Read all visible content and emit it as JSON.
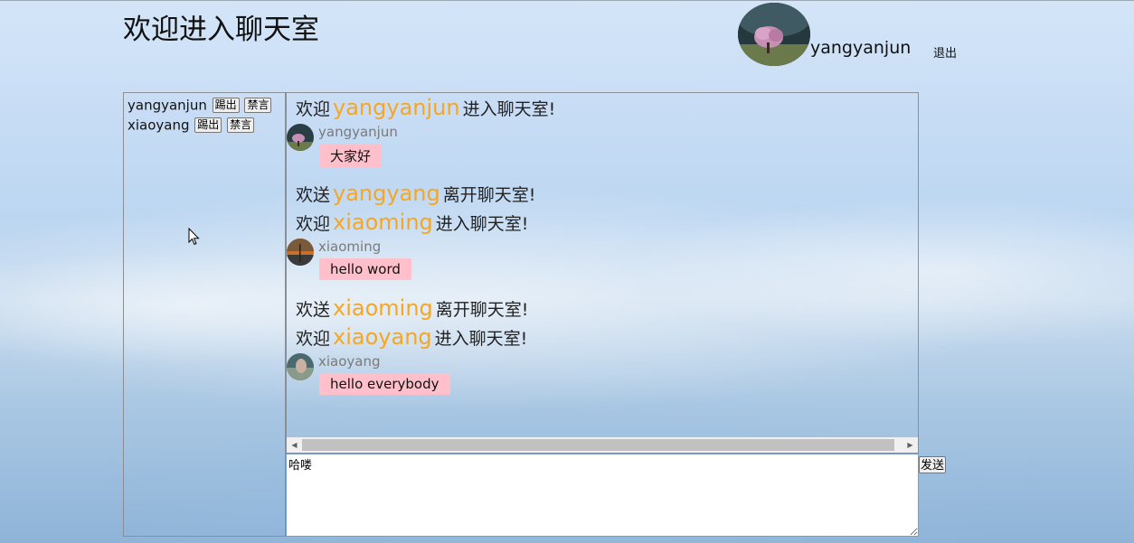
{
  "header": {
    "title": "欢迎进入聊天室",
    "current_user": "yangyanjun",
    "logout_label": "退出"
  },
  "users_panel": {
    "kick_label": "踢出",
    "mute_label": "禁言",
    "users": [
      {
        "name": "yangyanjun"
      },
      {
        "name": "xiaoyang"
      }
    ]
  },
  "chat": {
    "entries": [
      {
        "type": "system",
        "prefix": "欢迎",
        "user": "yangyanjun",
        "suffix": "进入聊天室!"
      },
      {
        "type": "message",
        "sender": "yangyanjun",
        "text": "大家好"
      },
      {
        "type": "system",
        "prefix": "欢送",
        "user": "yangyang",
        "suffix": "离开聊天室!"
      },
      {
        "type": "system",
        "prefix": "欢迎",
        "user": "xiaoming",
        "suffix": "进入聊天室!"
      },
      {
        "type": "message",
        "sender": "xiaoming",
        "text": "hello word"
      },
      {
        "type": "system",
        "prefix": "欢送",
        "user": "xiaoming",
        "suffix": "离开聊天室!"
      },
      {
        "type": "system",
        "prefix": "欢迎",
        "user": "xiaoyang",
        "suffix": "进入聊天室!"
      },
      {
        "type": "message",
        "sender": "xiaoyang",
        "text": "hello everybody"
      }
    ]
  },
  "composer": {
    "value": "哈喽",
    "send_label": "发送"
  },
  "colors": {
    "highlight_user": "#f5a623",
    "bubble": "#ffc0cb",
    "sender_name": "#7a7a7a"
  }
}
